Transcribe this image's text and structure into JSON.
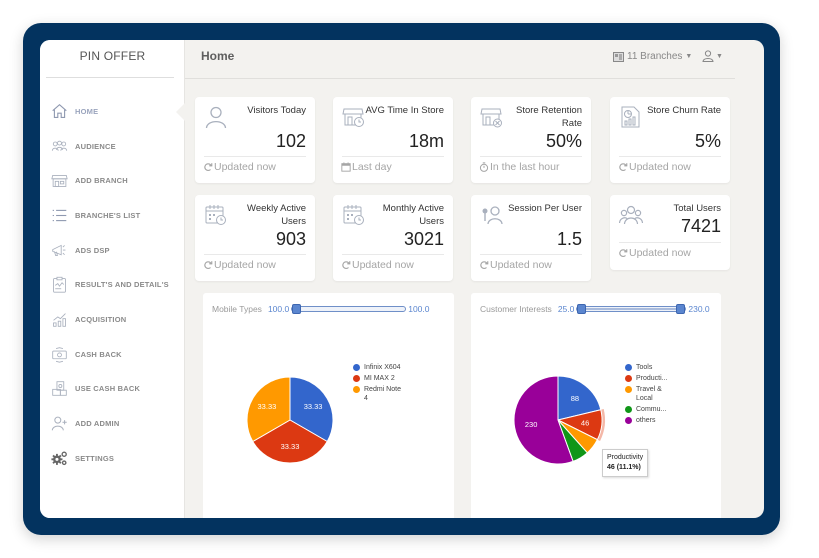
{
  "brand": "PIN OFFER",
  "header": {
    "title": "Home",
    "branches_label": "11 Branches"
  },
  "sidebar": {
    "items": [
      {
        "label": "HOME",
        "icon": "home-icon",
        "active": true
      },
      {
        "label": "AUDIENCE",
        "icon": "audience-icon"
      },
      {
        "label": "ADD BRANCH",
        "icon": "store-icon"
      },
      {
        "label": "BRANCHE'S LIST",
        "icon": "list-icon"
      },
      {
        "label": "ADS DSP",
        "icon": "megaphone-icon"
      },
      {
        "label": "RESULT'S AND DETAIL'S",
        "icon": "clipboard-chart-icon"
      },
      {
        "label": "ACQUISITION",
        "icon": "growth-chart-icon"
      },
      {
        "label": "CASH BACK",
        "icon": "cash-back-icon"
      },
      {
        "label": "USE CASH BACK",
        "icon": "use-cash-icon"
      },
      {
        "label": "ADD ADMIN",
        "icon": "add-user-icon"
      },
      {
        "label": "SETTINGS",
        "icon": "gears-icon"
      }
    ]
  },
  "cards": [
    {
      "title": "Visitors Today",
      "value": "102",
      "footer": "Updated now",
      "icon": "user-icon",
      "footer_icon": "refresh-icon"
    },
    {
      "title": "AVG Time In Store",
      "value": "18m",
      "footer": "Last day",
      "icon": "store-clock-icon",
      "footer_icon": "calendar-icon"
    },
    {
      "title": "Store Retention Rate",
      "value": "50%",
      "footer": "In the last hour",
      "icon": "store-retention-icon",
      "footer_icon": "stopwatch-icon"
    },
    {
      "title": "Store Churn Rate",
      "value": "5%",
      "footer": "Updated now",
      "icon": "report-chart-icon",
      "footer_icon": "refresh-icon"
    },
    {
      "title": "Weekly Active Users",
      "value": "903",
      "footer": "Updated now",
      "icon": "calendar-clock-icon",
      "footer_icon": "refresh-icon"
    },
    {
      "title": "Monthly Active Users",
      "value": "3021",
      "footer": "Updated now",
      "icon": "calendar-clock-icon",
      "footer_icon": "refresh-icon"
    },
    {
      "title": "Session Per User",
      "value": "1.5",
      "footer": "Updated now",
      "icon": "pin-user-icon",
      "footer_icon": "refresh-icon"
    },
    {
      "title": "Total Users",
      "value": "7421",
      "footer": "Updated now",
      "icon": "group-icon",
      "footer_icon": "refresh-icon"
    }
  ],
  "chart_data": [
    {
      "type": "pie",
      "title": "Mobile Types",
      "range": {
        "min": "100.0",
        "max": "100.0",
        "low_fraction": 0.0,
        "high_fraction": 1.0
      },
      "categories": [
        "Infinix X604",
        "MI MAX 2",
        "Redmi Note 4"
      ],
      "values": [
        33.33,
        33.33,
        33.33
      ],
      "data_labels": [
        "33.33",
        "33.33",
        "33.33"
      ],
      "colors": [
        "#3366cc",
        "#dc3912",
        "#ff9900"
      ],
      "legend": "right"
    },
    {
      "type": "pie",
      "title": "Customer Interests",
      "range": {
        "min": "25.0",
        "max": "230.0",
        "low_fraction": 0.0,
        "high_fraction": 1.0
      },
      "categories": [
        "Tools",
        "Productivity",
        "Travel & Local",
        "Communication",
        "others"
      ],
      "legend_labels": [
        "Tools",
        "Producti...",
        "Travel & Local",
        "Commu...",
        "others"
      ],
      "values": [
        88,
        46,
        25,
        25,
        230
      ],
      "data_labels": [
        "88",
        "46",
        "",
        "",
        "230"
      ],
      "colors": [
        "#3366cc",
        "#dc3912",
        "#ff9900",
        "#109618",
        "#990099"
      ],
      "legend": "right",
      "tooltip": {
        "title": "Productivity",
        "value": "46 (11.1%)"
      }
    }
  ]
}
